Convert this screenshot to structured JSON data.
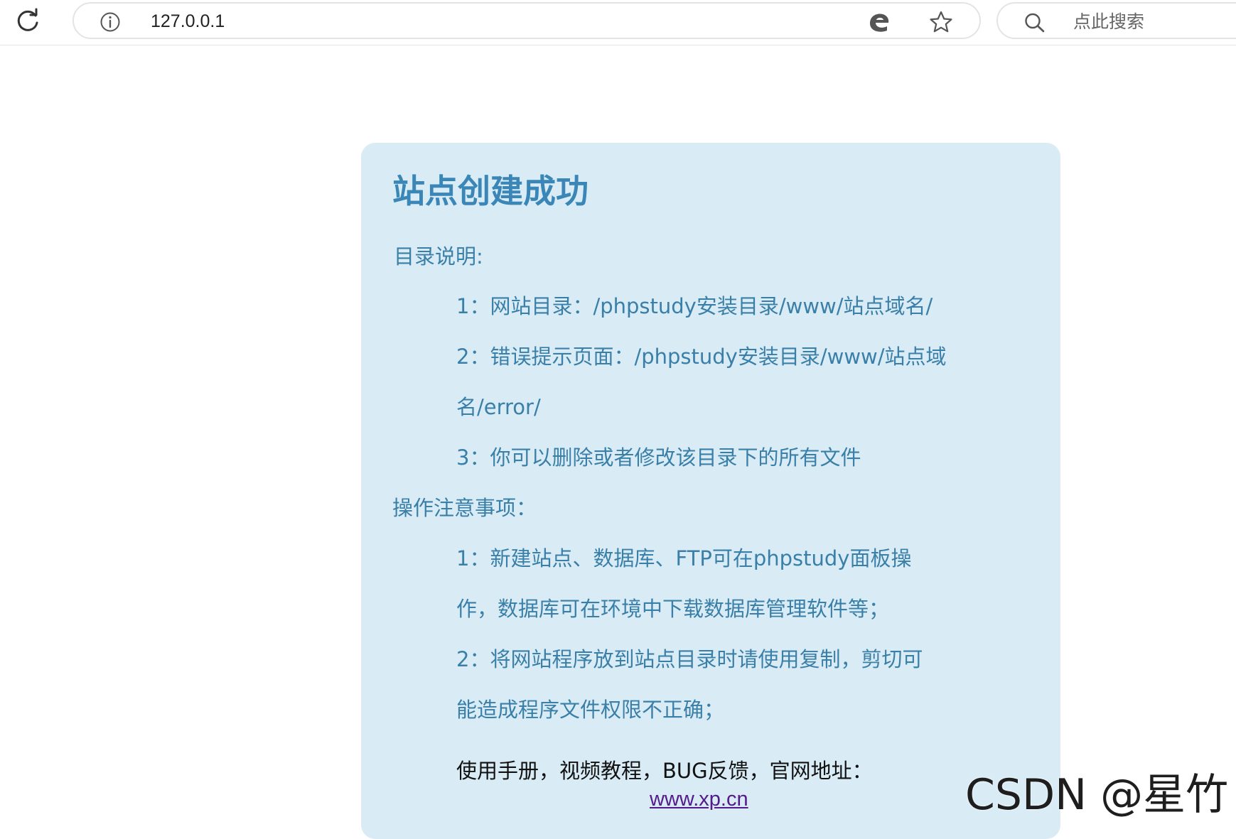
{
  "browser": {
    "url": "127.0.0.1",
    "search_placeholder": "点此搜索",
    "icons": {
      "reload": "reload-icon",
      "info": "info-icon",
      "engine": "search-engine-icon",
      "favorite": "star-icon",
      "search": "search-icon"
    }
  },
  "page": {
    "title": "站点创建成功",
    "dir_heading": "目录说明:",
    "dir_items": [
      "1：网站目录：/phpstudy安装目录/www/站点域名/",
      "2：错误提示页面：/phpstudy安装目录/www/站点域",
      "名/error/",
      "3：你可以删除或者修改该目录下的所有文件"
    ],
    "notes_heading": "操作注意事项：",
    "notes_items": [
      "1：新建站点、数据库、FTP可在phpstudy面板操",
      "作，数据库可在环境中下载数据库管理软件等；",
      "2：将网站程序放到站点目录时请使用复制，剪切可",
      "能造成程序文件权限不正确；"
    ],
    "resources_line": "使用手册，视频教程，BUG反馈，官网地址：",
    "site_link": "www.xp.cn"
  },
  "watermark": "CSDN @星竹",
  "colors": {
    "card_bg": "#d9ecf6",
    "title": "#3a86b7",
    "text": "#3a7fa8",
    "link": "#551a8b"
  }
}
